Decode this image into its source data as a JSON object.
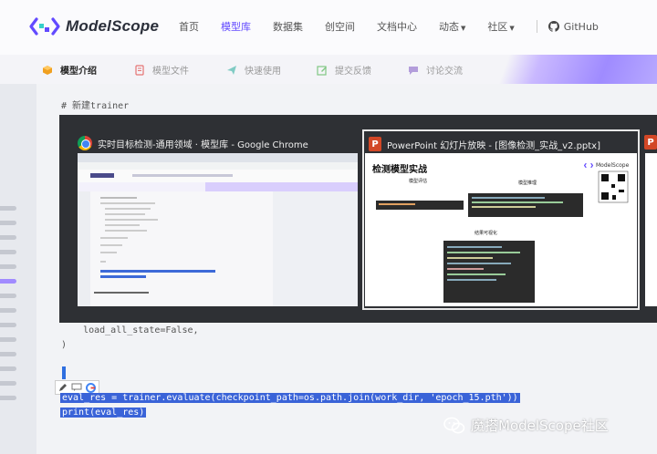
{
  "brand": {
    "name": "ModelScope",
    "accent": "#624aff"
  },
  "nav": {
    "items": [
      {
        "label": "首页"
      },
      {
        "label": "模型库",
        "active": true
      },
      {
        "label": "数据集"
      },
      {
        "label": "创空间"
      },
      {
        "label": "文档中心"
      },
      {
        "label": "动态",
        "dropdown": true
      },
      {
        "label": "社区",
        "dropdown": true
      }
    ],
    "github_label": "GitHub"
  },
  "subtabs": [
    {
      "label": "模型介绍",
      "active": true,
      "icon": "cube-icon"
    },
    {
      "label": "模型文件",
      "icon": "file-icon"
    },
    {
      "label": "快速使用",
      "icon": "send-icon"
    },
    {
      "label": "提交反馈",
      "icon": "edit-icon"
    },
    {
      "label": "讨论交流",
      "icon": "chat-icon"
    }
  ],
  "code": {
    "comment": "# 新建trainer",
    "line_load": "    load_all_state=False,",
    "line_close": ")",
    "selected_1": "eval_res = trainer.evaluate(checkpoint_path=os.path.join(work_dir, 'epoch_15.pth'))",
    "selected_2": "print(eval_res)"
  },
  "windows": {
    "chrome_title": "实时目标检测-通用领域 · 模型库 - Google Chrome",
    "ppt_title": "PowerPoint 幻灯片放映 - [图像检测_实战_v2.pptx]"
  },
  "slide": {
    "title": "检测模型实战",
    "brand": "ModelScope",
    "label_left": "模型评估",
    "label_right": "模型推理",
    "label_bottom": "结果可视化"
  },
  "watermark": "魔搭ModelScope社区"
}
